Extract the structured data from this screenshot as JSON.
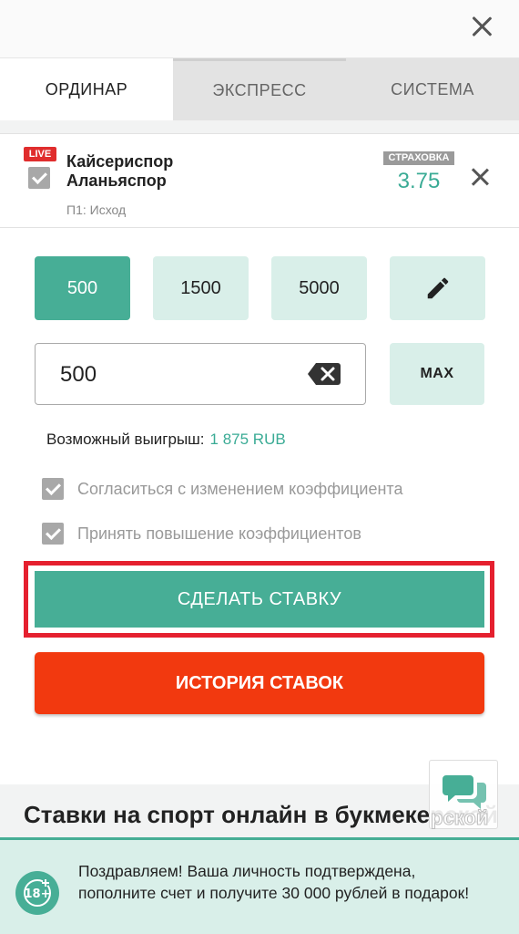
{
  "tabs": [
    {
      "label": "ОРДИНАР"
    },
    {
      "label": "ЭКСПРЕСС"
    },
    {
      "label": "СИСТЕМА"
    }
  ],
  "bet": {
    "live_badge": "LIVE",
    "team1": "Кайсериспор",
    "team2": "Аланьяспор",
    "market": "П1: Исход",
    "insurance": "СТРАХОВКА",
    "coefficient": "3.75"
  },
  "quick_stakes": [
    "500",
    "1500",
    "5000"
  ],
  "stake": {
    "value": "500",
    "max_label": "MAX"
  },
  "winnings": {
    "label": "Возможный выигрыш:",
    "amount": "1 875 RUB"
  },
  "options": [
    {
      "label": "Согласиться с изменением коэффициента",
      "checked": true
    },
    {
      "label": "Принять повышение коэффициентов",
      "checked": true
    }
  ],
  "actions": {
    "place_bet": "СДЕЛАТЬ СТАВКУ",
    "history": "ИСТОРИЯ СТАВОК"
  },
  "promo": {
    "heading": "Ставки на спорт онлайн в букмекерской",
    "chat_overlay": "рской"
  },
  "notice": {
    "badge": "18+",
    "text": "Поздравляем! Ваша личность подтверждена, пополните счет и получите 30 000 рублей в подарок!"
  },
  "colors": {
    "accent": "#47ae96",
    "accent_light": "#d9efe9",
    "danger": "#f2390f",
    "highlight": "#e5202f",
    "live": "#e02d2d"
  }
}
